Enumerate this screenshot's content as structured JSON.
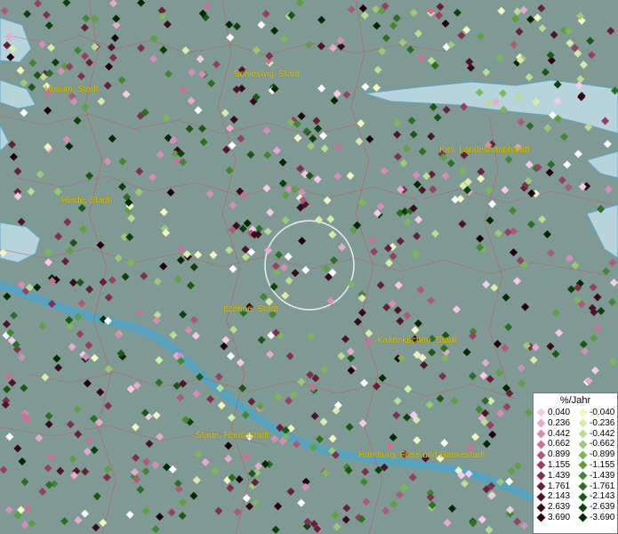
{
  "labels": {
    "husum": "Husum, Stadt",
    "schleswig": "Schleswig, Stadt",
    "kiel": "Kiel, Landeshauptstadt",
    "heide": "Heide, Stadt",
    "itzehoe": "Itzehoe, Stadt",
    "kaltenkirchen": "Kaltenkirchen, Stadt",
    "stade": "Stade, Hansestadt",
    "hamburg": "Hamburg, Freie und Hansestadt"
  },
  "legend": {
    "title": "%/Jahr",
    "positive": [
      {
        "value": "0.040",
        "color": "#f8c8e8"
      },
      {
        "value": "0.236",
        "color": "#e8a8d0"
      },
      {
        "value": "0.442",
        "color": "#d88cb8"
      },
      {
        "value": "0.662",
        "color": "#c87098"
      },
      {
        "value": "0.899",
        "color": "#b05878"
      },
      {
        "value": "1.155",
        "color": "#984060"
      },
      {
        "value": "1.439",
        "color": "#80304c"
      },
      {
        "value": "1.761",
        "color": "#682038"
      },
      {
        "value": "2.143",
        "color": "#501428"
      },
      {
        "value": "2.639",
        "color": "#3a0a1a"
      },
      {
        "value": "3.690",
        "color": "#220008"
      }
    ],
    "negative": [
      {
        "value": "-0.040",
        "color": "#f0f8c0"
      },
      {
        "value": "-0.236",
        "color": "#d8ecaa"
      },
      {
        "value": "-0.442",
        "color": "#bcdc90"
      },
      {
        "value": "-0.662",
        "color": "#9cca74"
      },
      {
        "value": "-0.899",
        "color": "#7cb858"
      },
      {
        "value": "-1.155",
        "color": "#5ca040"
      },
      {
        "value": "-1.439",
        "color": "#408830"
      },
      {
        "value": "-1.761",
        "color": "#2a7020"
      },
      {
        "value": "-2.143",
        "color": "#1a5814"
      },
      {
        "value": "-2.639",
        "color": "#0c420a"
      },
      {
        "value": "-3.690",
        "color": "#022a02"
      }
    ]
  }
}
